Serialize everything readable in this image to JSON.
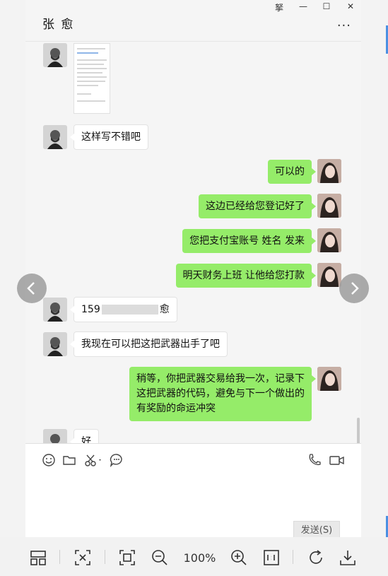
{
  "window": {
    "title": "张 愈",
    "controls": {
      "pin": "拏",
      "minimize": "—",
      "maximize": "☐",
      "close": "✕"
    },
    "more": "···"
  },
  "messages": [
    {
      "side": "in",
      "type": "image",
      "label": ""
    },
    {
      "side": "in",
      "text": "这样写不错吧"
    },
    {
      "side": "out",
      "text": "可以的"
    },
    {
      "side": "out",
      "text": "这边已经给您登记好了"
    },
    {
      "side": "out",
      "text": "您把支付宝账号  姓名 发来"
    },
    {
      "side": "out",
      "text": "明天财务上班 让他给您打款"
    },
    {
      "side": "in",
      "text_prefix": "159",
      "text_suffix": "愈"
    },
    {
      "side": "in",
      "text": "我现在可以把这把武器出手了吧"
    },
    {
      "side": "out",
      "text": "稍等，你把武器交易给我一次，记录下这把武器的代码，避免与下一个做出的有奖励的命运冲突"
    },
    {
      "side": "in",
      "text": "好"
    }
  ],
  "input": {
    "tools": [
      "emoji-icon",
      "folder-icon",
      "scissors-icon",
      "chat-history-icon",
      "phone-icon",
      "video-icon"
    ],
    "send_label": "发送(S)"
  },
  "viewer": {
    "zoom": "100%",
    "tools": [
      "layout-icon",
      "crop-icon",
      "fit-icon",
      "zoom-out-icon",
      "zoom-in-icon",
      "actual-size-icon",
      "rotate-icon",
      "download-icon"
    ]
  },
  "colors": {
    "outgoing_bubble": "#95ec69",
    "incoming_bubble": "#ffffff",
    "chat_background": "#f5f5f5"
  }
}
